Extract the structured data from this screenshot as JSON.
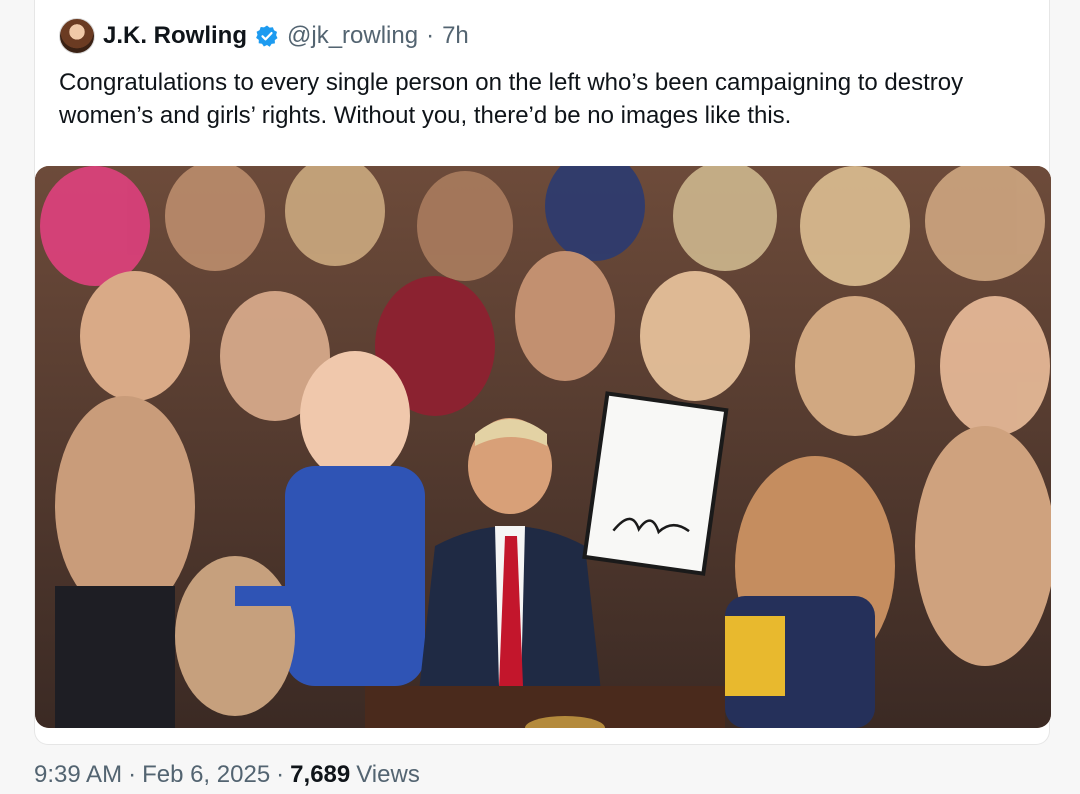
{
  "tweet": {
    "author": {
      "display_name": "J.K. Rowling",
      "handle": "@jk_rowling",
      "separator": "·",
      "relative_time": "7h"
    },
    "text": "Congratulations to every single person on the left who’s been campaigning to destroy women’s and girls’ rights. Without you, there’d be no images like this.",
    "footer": {
      "time": "9:39 AM",
      "date": "Feb 6, 2025",
      "separator": "·",
      "views_count": "7,689",
      "views_label": "Views"
    }
  },
  "icons": {
    "verified": "verified-badge-icon",
    "avatar": "profile-avatar"
  },
  "colors": {
    "verified_blue": "#1d9bf0",
    "secondary_text": "#536471",
    "primary_text": "#0f1419"
  }
}
